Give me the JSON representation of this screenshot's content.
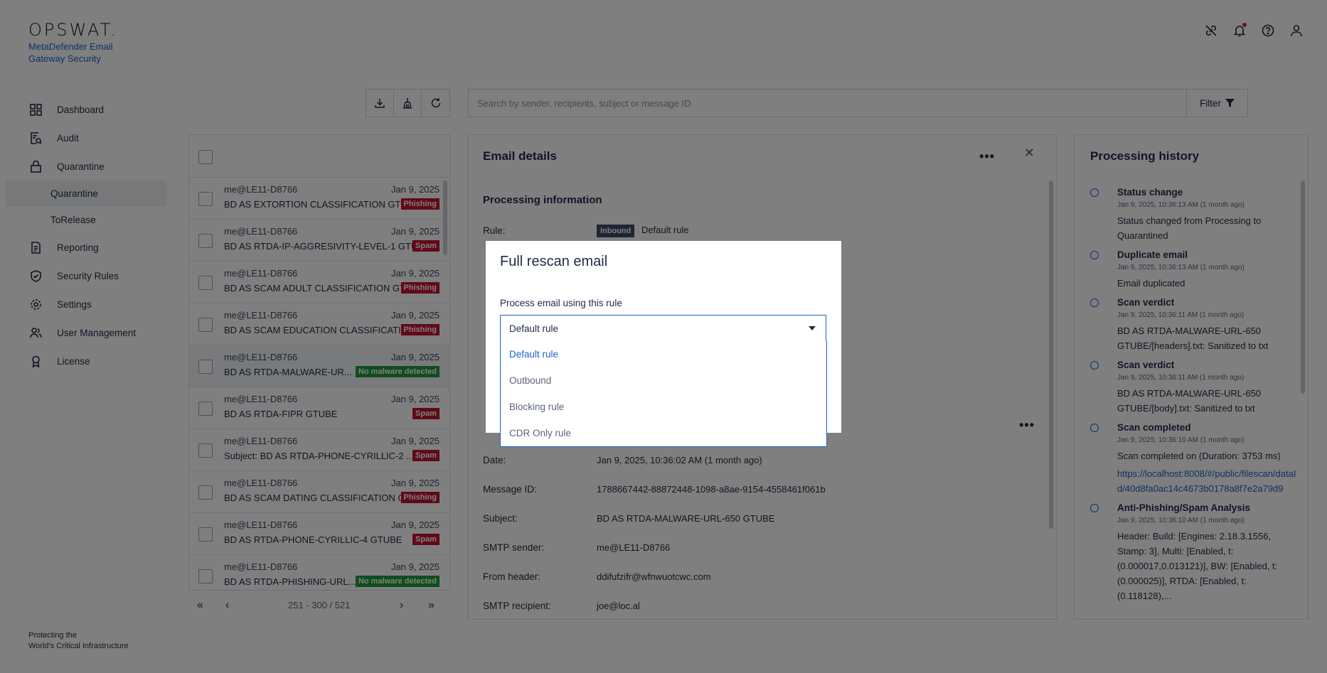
{
  "brand": {
    "logo": "OPSWAT.",
    "product": "MetaDefender Email Gateway Security",
    "tagline_1": "Protecting the",
    "tagline_2": "World's Critical Infrastructure"
  },
  "nav": {
    "dashboard": "Dashboard",
    "audit": "Audit",
    "quarantine": "Quarantine",
    "quarantine_sub": "Quarantine",
    "torelease": "ToRelease",
    "reporting": "Reporting",
    "security_rules": "Security Rules",
    "settings": "Settings",
    "user_management": "User Management",
    "license": "License"
  },
  "search": {
    "placeholder": "Search by sender, recipients, subject or message ID",
    "filter_label": "Filter"
  },
  "emails": [
    {
      "from": "me@LE11-D8766",
      "date": "Jan 9, 2025",
      "subject": "BD AS EXTORTION CLASSIFICATION GTU...",
      "badge": "Phishing"
    },
    {
      "from": "me@LE11-D8766",
      "date": "Jan 9, 2025",
      "subject": "BD AS RTDA-IP-AGGRESIVITY-LEVEL-1 GTU...",
      "badge": "Spam"
    },
    {
      "from": "me@LE11-D8766",
      "date": "Jan 9, 2025",
      "subject": "BD AS SCAM ADULT CLASSIFICATION GT...",
      "badge": "Phishing"
    },
    {
      "from": "me@LE11-D8766",
      "date": "Jan 9, 2025",
      "subject": "BD AS SCAM EDUCATION CLASSIFICATI...",
      "badge": "Phishing"
    },
    {
      "from": "me@LE11-D8766",
      "date": "Jan 9, 2025",
      "subject": "BD AS RTDA-MALWARE-UR...",
      "badge": "No malware detected"
    },
    {
      "from": "me@LE11-D8766",
      "date": "Jan 9, 2025",
      "subject": "BD AS RTDA-FIPR GTUBE",
      "badge": "Spam"
    },
    {
      "from": "me@LE11-D8766",
      "date": "Jan 9, 2025",
      "subject": "Subject: BD AS RTDA-PHONE-CYRILLIC-2 ...",
      "badge": "Spam"
    },
    {
      "from": "me@LE11-D8766",
      "date": "Jan 9, 2025",
      "subject": "BD AS SCAM DATING CLASSIFICATION G...",
      "badge": "Phishing"
    },
    {
      "from": "me@LE11-D8766",
      "date": "Jan 9, 2025",
      "subject": "BD AS RTDA-PHONE-CYRILLIC-4 GTUBE",
      "badge": "Spam"
    },
    {
      "from": "me@LE11-D8766",
      "date": "Jan 9, 2025",
      "subject": "BD AS RTDA-PHISHING-URL...",
      "badge": "No malware detected"
    }
  ],
  "pager": {
    "range": "251 - 300 / 521"
  },
  "details": {
    "title": "Email details",
    "section": "Processing information",
    "rule_label": "Rule:",
    "rule_badge": "Inbound",
    "rule_value": "Default rule",
    "fields": [
      {
        "label": "Date:",
        "value": "Jan 9, 2025, 10:36:02 AM (1 month ago)"
      },
      {
        "label": "Message ID:",
        "value": "1788667442-88872448-1098-a8ae-9154-4558461f061b"
      },
      {
        "label": "Subject:",
        "value": "BD AS RTDA-MALWARE-URL-650 GTUBE"
      },
      {
        "label": "SMTP sender:",
        "value": "me@LE11-D8766"
      },
      {
        "label": "From header:",
        "value": "ddifufzifr@wfnwuotcwc.com"
      },
      {
        "label": "SMTP recipient:",
        "value": "joe@loc.al"
      }
    ]
  },
  "history": {
    "title": "Processing history",
    "items": [
      {
        "title": "Status change",
        "time": "Jan 9, 2025, 10:36:13 AM (1 month ago)",
        "desc": "Status changed from Processing to Quarantined"
      },
      {
        "title": "Duplicate email",
        "time": "Jan 9, 2025, 10:36:13 AM (1 month ago)",
        "desc": "Email duplicated"
      },
      {
        "title": "Scan verdict",
        "time": "Jan 9, 2025, 10:36:11 AM (1 month ago)",
        "desc": "BD AS RTDA-MALWARE-URL-650 GTUBE/[headers].txt: Sanitized to txt"
      },
      {
        "title": "Scan verdict",
        "time": "Jan 9, 2025, 10:36:11 AM (1 month ago)",
        "desc": "BD AS RTDA-MALWARE-URL-650 GTUBE/[body].txt: Sanitized to txt"
      },
      {
        "title": "Scan completed",
        "time": "Jan 9, 2025, 10:36:10 AM (1 month ago)",
        "desc": "Scan completed on (Duration: 3753 ms)",
        "link": "https://localhost:8008/#/public/filescan/dataId/40d8fa0ac14c4673b0178a8f7e2a79d9"
      },
      {
        "title": "Anti-Phishing/Spam Analysis",
        "time": "Jan 9, 2025, 10:36:10 AM (1 month ago)",
        "desc": "Header: Build: [Engines: 2.18.3.1556, Stamp: 3], Multi: [Enabled, t: (0.000017,0.013121)], BW: [Enabled, t: (0.000025)], RTDA: [Enabled, t: (0.118128),..."
      }
    ]
  },
  "modal": {
    "title": "Full rescan email",
    "label": "Process email using this rule",
    "selected": "Default rule",
    "options": [
      "Default rule",
      "Outbound",
      "Blocking rule",
      "CDR Only rule"
    ]
  },
  "colors": {
    "accent": "#1d62c9",
    "phishing": "#c4122f",
    "clean": "#1e9b3c",
    "inbound": "#3c4a66"
  }
}
